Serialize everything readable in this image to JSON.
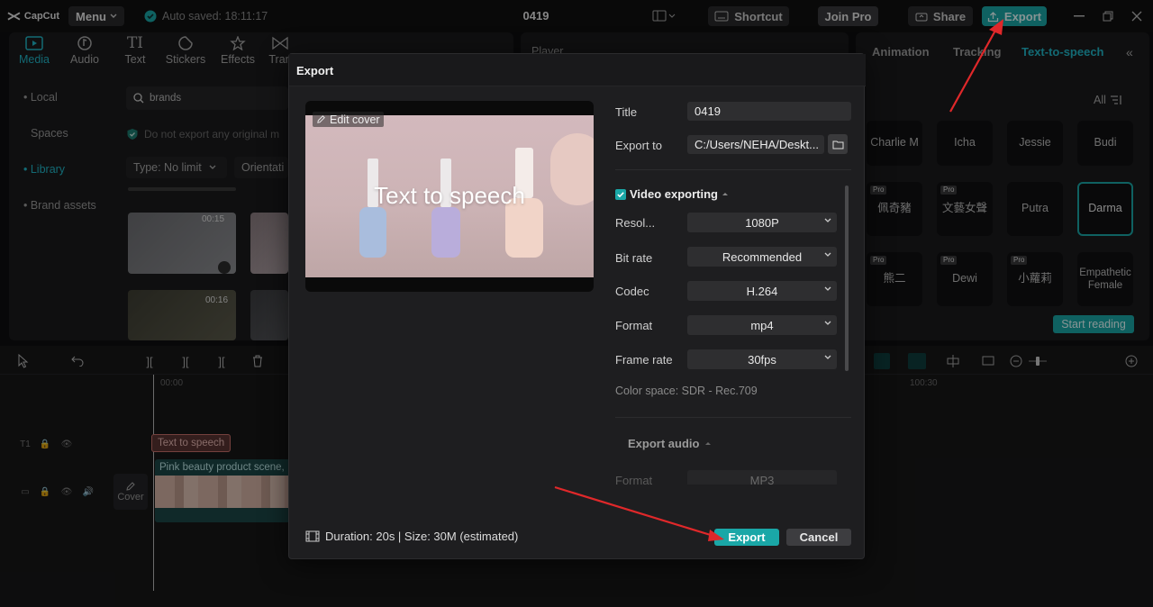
{
  "topbar": {
    "logo": "CapCut",
    "menu_label": "Menu",
    "autosave_text": "Auto saved: 18:11:17",
    "project_title": "0419",
    "shortcut_label": "Shortcut",
    "join_pro_label": "Join Pro",
    "share_label": "Share",
    "export_label": "Export"
  },
  "media_tabs": [
    {
      "label": "Media",
      "icon": "media-icon"
    },
    {
      "label": "Audio",
      "icon": "audio-icon"
    },
    {
      "label": "Text",
      "icon": "text-icon"
    },
    {
      "label": "Stickers",
      "icon": "stickers-icon"
    },
    {
      "label": "Effects",
      "icon": "effects-icon"
    },
    {
      "label": "Tran",
      "icon": "transitions-icon"
    }
  ],
  "sidebar": {
    "items": [
      {
        "label": "• Local"
      },
      {
        "label": "Spaces"
      },
      {
        "label": "• Library"
      },
      {
        "label": "• Brand assets"
      }
    ]
  },
  "library": {
    "search_value": "brands",
    "notice": "Do not export any original m",
    "filter_type": "Type: No limit",
    "filter_orientation": "Orientati",
    "thumb_durations": [
      "00:15",
      "00:16"
    ]
  },
  "player": {
    "title": "Player"
  },
  "right_panel": {
    "tabs": [
      "Animation",
      "Tracking",
      "Text-to-speech"
    ],
    "filter_label": "All",
    "voices_row1": [
      "Charlie M",
      "Icha",
      "Jessie",
      "Budi"
    ],
    "voices_row2": [
      "佩奇豬",
      "文藝女聲",
      "Putra",
      "Darma"
    ],
    "voices_row3": [
      "熊二",
      "Dewi",
      "小蘿莉",
      "Empathetic Female"
    ],
    "pro_badge": "Pro",
    "start_reading_label": "Start reading"
  },
  "timeline": {
    "time_start": "00:00",
    "time_mark": "100:30",
    "text_clip_label": "Text to speech",
    "video_clip_label": "Pink beauty product scene,",
    "cover_label": "Cover"
  },
  "export_dialog": {
    "header": "Export",
    "edit_cover_label": "Edit cover",
    "preview_overlay_text": "Text to speech",
    "title_label": "Title",
    "title_value": "0419",
    "export_to_label": "Export to",
    "export_to_value": "C:/Users/NEHA/Deskt...",
    "video_exporting_label": "Video exporting",
    "resolution_label": "Resol...",
    "resolution_value": "1080P",
    "bitrate_label": "Bit rate",
    "bitrate_value": "Recommended",
    "codec_label": "Codec",
    "codec_value": "H.264",
    "format_label": "Format",
    "format_value": "mp4",
    "framerate_label": "Frame rate",
    "framerate_value": "30fps",
    "color_space": "Color space: SDR - Rec.709",
    "export_audio_label": "Export audio",
    "audio_format_label": "Format",
    "audio_format_value": "MP3",
    "footer_info": "Duration: 20s | Size: 30M (estimated)",
    "export_button": "Export",
    "cancel_button": "Cancel"
  },
  "colors": {
    "accent": "#1aa7a7",
    "accent_text": "#21b7c9",
    "annotation_arrow": "#e0282a",
    "modal_bg": "#1e1e20"
  }
}
